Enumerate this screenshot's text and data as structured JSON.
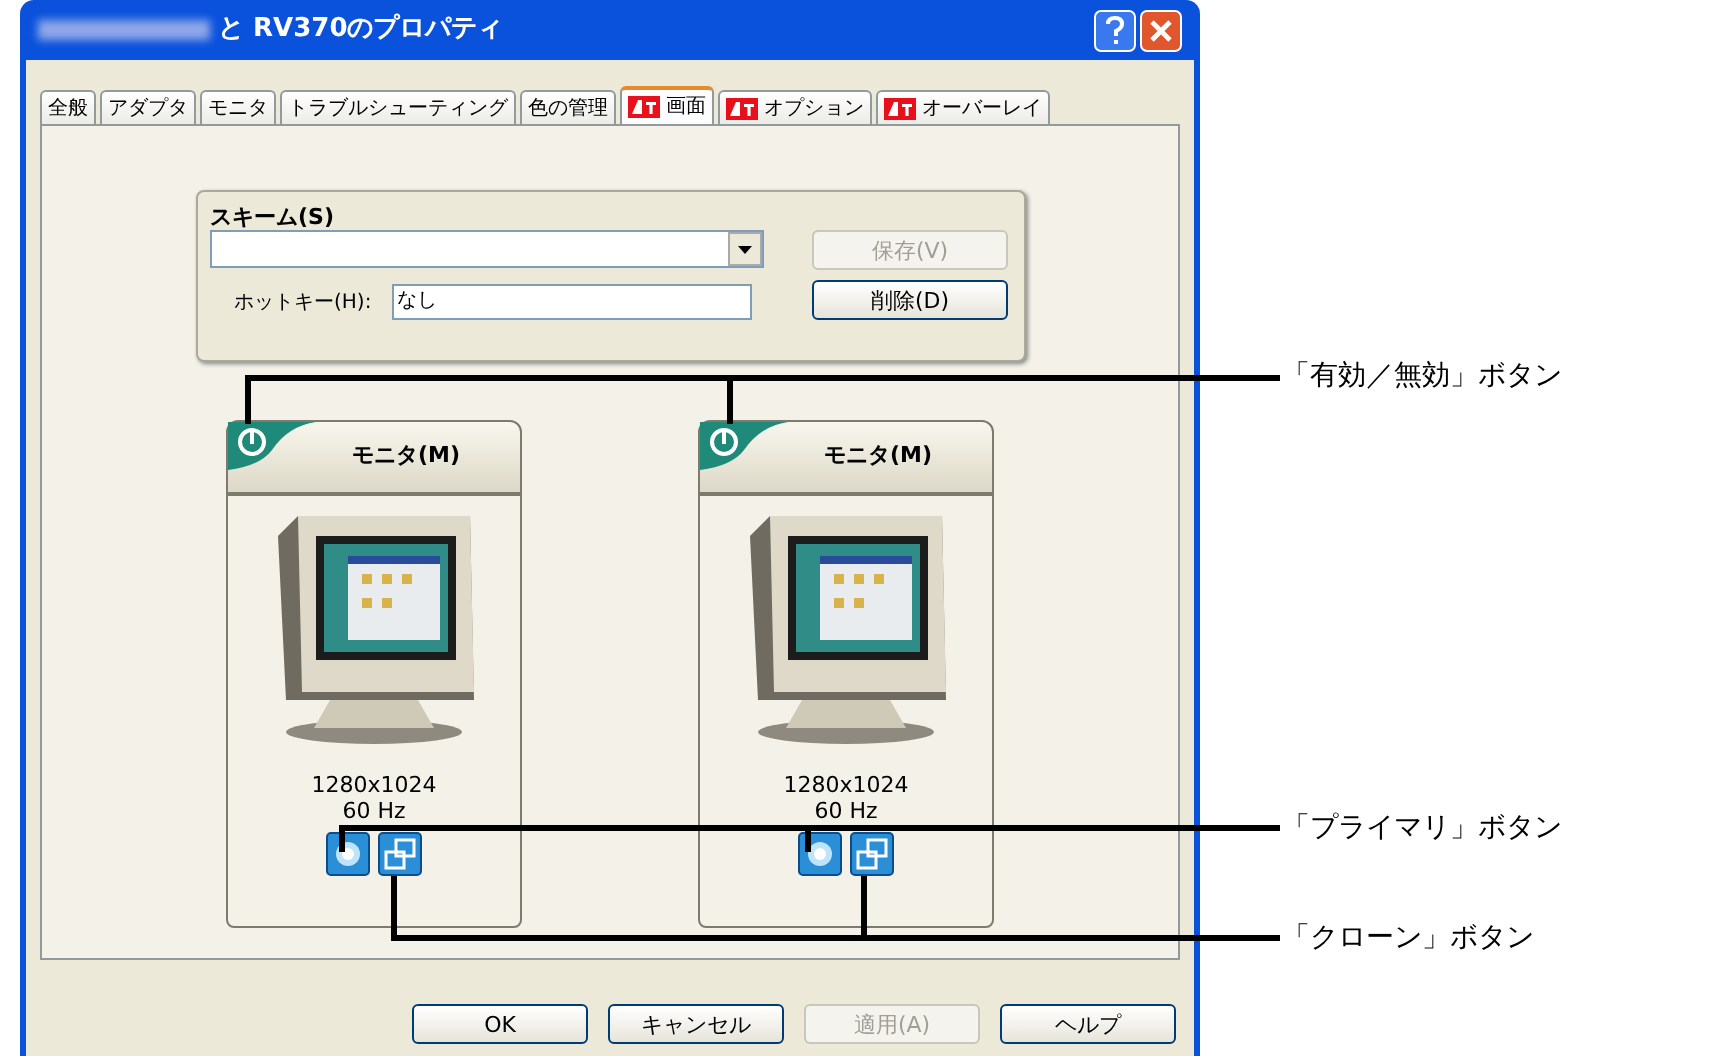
{
  "window": {
    "title": "と RV370のプロパティ"
  },
  "tabs": [
    {
      "label": "全般",
      "kind": "plain",
      "selected": false
    },
    {
      "label": "アダプタ",
      "kind": "plain",
      "selected": false
    },
    {
      "label": "モニタ",
      "kind": "plain",
      "selected": false
    },
    {
      "label": "トラブルシューティング",
      "kind": "plain",
      "selected": false
    },
    {
      "label": "色の管理",
      "kind": "plain",
      "selected": false
    },
    {
      "label": "画面",
      "kind": "ati",
      "selected": true
    },
    {
      "label": "オプション",
      "kind": "ati",
      "selected": false
    },
    {
      "label": "オーバーレイ",
      "kind": "ati",
      "selected": false
    }
  ],
  "scheme": {
    "label": "スキーム(S)",
    "save_button": {
      "label": "保存(V)",
      "disabled": true
    },
    "hotkey_label": "ホットキー(H):",
    "hotkey_value": "なし",
    "delete_button": {
      "label": "削除(D)",
      "disabled": false
    }
  },
  "monitors": [
    {
      "label": "モニタ(M)",
      "enabled": true,
      "resolution": "1280x1024",
      "refresh": "60 Hz"
    },
    {
      "label": "モニタ(M)",
      "enabled": true,
      "resolution": "1280x1024",
      "refresh": "60 Hz"
    }
  ],
  "buttons": [
    {
      "label": "OK",
      "disabled": false
    },
    {
      "label": "キャンセル",
      "disabled": false
    },
    {
      "label": "適用(A)",
      "disabled": true
    },
    {
      "label": "ヘルプ",
      "disabled": false
    }
  ],
  "callouts": [
    "「有効／無効」ボタン",
    "「プライマリ」ボタン",
    "「クローン」ボタン"
  ]
}
